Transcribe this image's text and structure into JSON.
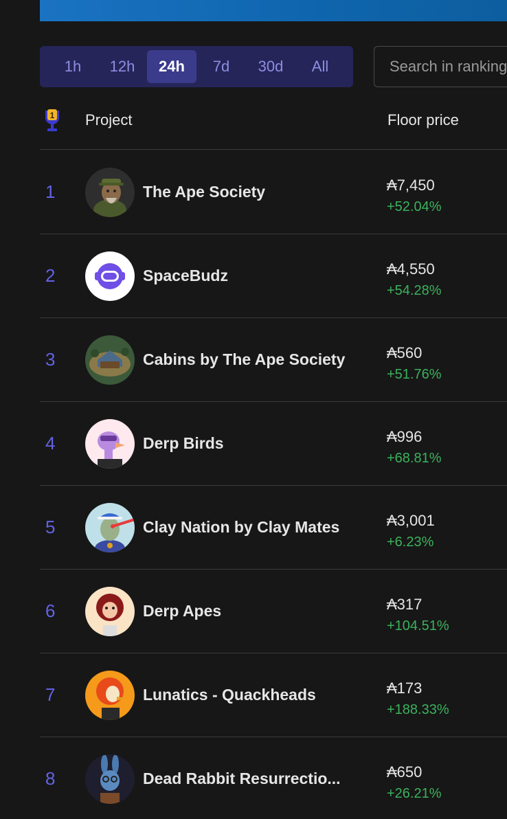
{
  "filters": {
    "options": [
      "1h",
      "12h",
      "24h",
      "7d",
      "30d",
      "All"
    ],
    "active": "24h"
  },
  "search": {
    "placeholder": "Search in rankings"
  },
  "table": {
    "header_rank_icon": "trophy-icon",
    "header_badge": "1",
    "col_project": "Project",
    "col_floor": "Floor price"
  },
  "rows": [
    {
      "rank": "1",
      "name": "The Ape Society",
      "price": "₳7,450",
      "change": "+52.04%",
      "avatar_icon": "ape-avatar-icon"
    },
    {
      "rank": "2",
      "name": "SpaceBudz",
      "price": "₳4,550",
      "change": "+54.28%",
      "avatar_icon": "spacebudz-logo-icon"
    },
    {
      "rank": "3",
      "name": "Cabins by The Ape Society",
      "price": "₳560",
      "change": "+51.76%",
      "avatar_icon": "cabin-avatar-icon"
    },
    {
      "rank": "4",
      "name": "Derp Birds",
      "price": "₳996",
      "change": "+68.81%",
      "avatar_icon": "bird-avatar-icon"
    },
    {
      "rank": "5",
      "name": "Clay Nation by Clay Mates",
      "price": "₳3,001",
      "change": "+6.23%",
      "avatar_icon": "clay-avatar-icon"
    },
    {
      "rank": "6",
      "name": "Derp Apes",
      "price": "₳317",
      "change": "+104.51%",
      "avatar_icon": "ape-avatar-icon"
    },
    {
      "rank": "7",
      "name": "Lunatics - Quackheads",
      "price": "₳173",
      "change": "+188.33%",
      "avatar_icon": "duck-avatar-icon"
    },
    {
      "rank": "8",
      "name": "Dead Rabbit Resurrectio...",
      "price": "₳650",
      "change": "+26.21%",
      "avatar_icon": "rabbit-avatar-icon"
    }
  ],
  "colors": {
    "accent": "#6262e6",
    "positive": "#3bb25c",
    "banner": "#1a73c2"
  }
}
